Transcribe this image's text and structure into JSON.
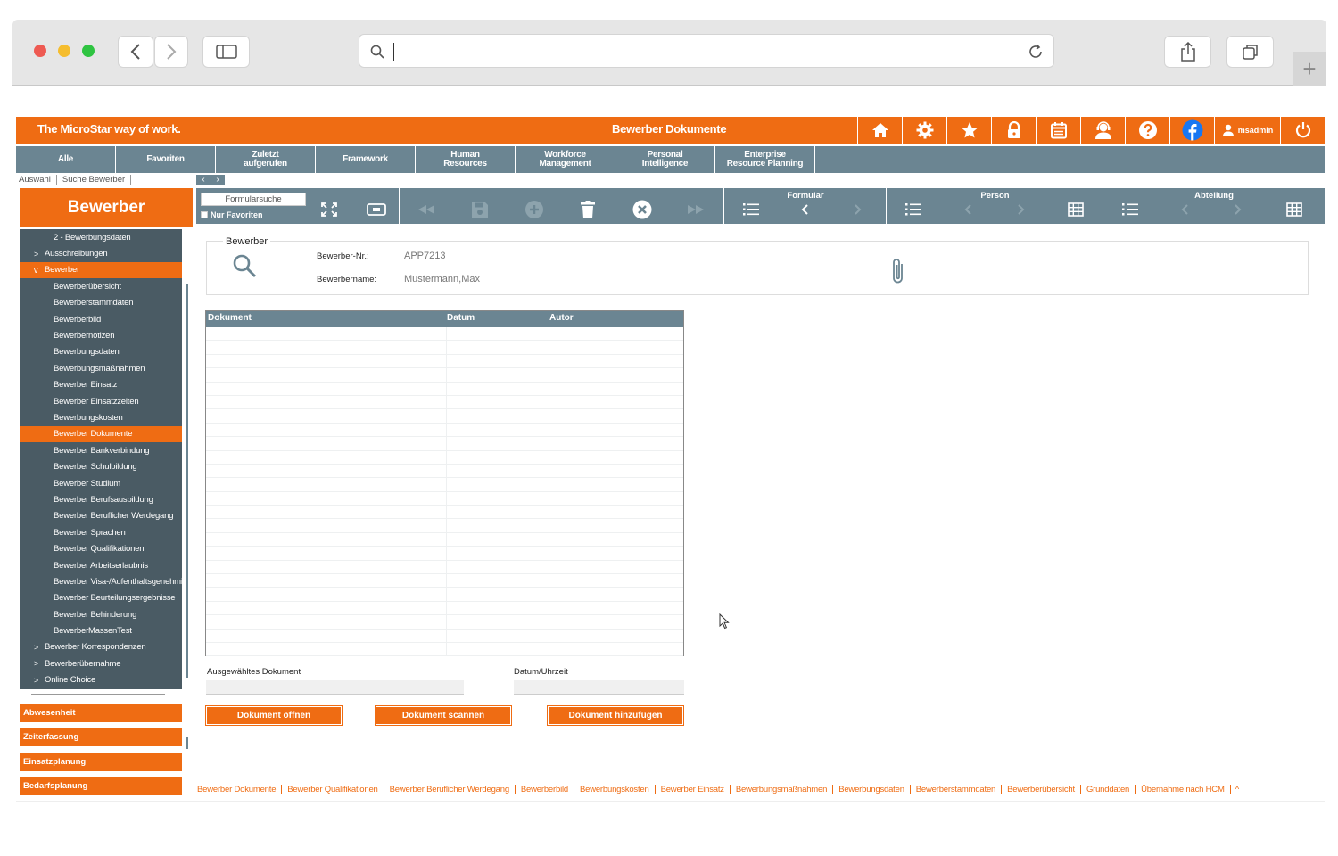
{
  "app": {
    "brand": "The MicroStar way of work.",
    "page_title": "Bewerber Dokumente",
    "user": "msadmin"
  },
  "nav": [
    "Alle",
    "Favoriten",
    "Zuletzt aufgerufen",
    "Framework",
    "Human Resources",
    "Workforce Management",
    "Personal Intelligence",
    "Enterprise Resource Planning"
  ],
  "breadcrumb": [
    "Auswahl",
    "Suche Bewerber"
  ],
  "sidebar": {
    "title": "Bewerber",
    "items": [
      {
        "label": "2 - Bewerbungsdaten",
        "level": 2,
        "caret": ""
      },
      {
        "label": "Ausschreibungen",
        "level": 1,
        "caret": ">"
      },
      {
        "label": "Bewerber",
        "level": 1,
        "caret": "v",
        "selected": true
      },
      {
        "label": "Bewerberübersicht",
        "level": 2,
        "caret": ""
      },
      {
        "label": "Bewerberstammdaten",
        "level": 2,
        "caret": ""
      },
      {
        "label": "Bewerberbild",
        "level": 2,
        "caret": ""
      },
      {
        "label": "Bewerbernotizen",
        "level": 2,
        "caret": ""
      },
      {
        "label": "Bewerbungsdaten",
        "level": 2,
        "caret": ""
      },
      {
        "label": "Bewerbungsmaßnahmen",
        "level": 2,
        "caret": ""
      },
      {
        "label": "Bewerber Einsatz",
        "level": 2,
        "caret": ""
      },
      {
        "label": "Bewerber Einsatzzeiten",
        "level": 2,
        "caret": ""
      },
      {
        "label": "Bewerbungskosten",
        "level": 2,
        "caret": ""
      },
      {
        "label": "Bewerber Dokumente",
        "level": 2,
        "caret": "",
        "selected": true
      },
      {
        "label": "Bewerber Bankverbindung",
        "level": 2,
        "caret": ""
      },
      {
        "label": "Bewerber Schulbildung",
        "level": 2,
        "caret": ""
      },
      {
        "label": "Bewerber Studium",
        "level": 2,
        "caret": ""
      },
      {
        "label": "Bewerber Berufsausbildung",
        "level": 2,
        "caret": ""
      },
      {
        "label": "Bewerber Beruflicher Werdegang",
        "level": 2,
        "caret": ""
      },
      {
        "label": "Bewerber Sprachen",
        "level": 2,
        "caret": ""
      },
      {
        "label": "Bewerber Qualifikationen",
        "level": 2,
        "caret": ""
      },
      {
        "label": "Bewerber Arbeitserlaubnis",
        "level": 2,
        "caret": ""
      },
      {
        "label": "Bewerber Visa-/Aufenthaltsgenehmigung",
        "level": 2,
        "caret": ""
      },
      {
        "label": "Bewerber Beurteilungsergebnisse",
        "level": 2,
        "caret": ""
      },
      {
        "label": "Bewerber Behinderung",
        "level": 2,
        "caret": ""
      },
      {
        "label": "BewerberMassenTest",
        "level": 2,
        "caret": ""
      },
      {
        "label": "Bewerber Korrespondenzen",
        "level": 1,
        "caret": ">"
      },
      {
        "label": "Bewerberübernahme",
        "level": 1,
        "caret": ">"
      },
      {
        "label": "Online Choice",
        "level": 1,
        "caret": ">"
      }
    ],
    "modules": [
      "Abwesenheit",
      "Zeiterfassung",
      "Einsatzplanung",
      "Bedarfsplanung"
    ]
  },
  "toolbar": {
    "search_placeholder": "Formularsuche",
    "only_favorites": "Nur Favoriten",
    "groups": [
      "Formular",
      "Person",
      "Abteilung"
    ]
  },
  "form": {
    "legend": "Bewerber",
    "nr_label": "Bewerber-Nr.:",
    "nr_value": "APP7213",
    "name_label": "Bewerbername:",
    "name_value": "Mustermann,Max"
  },
  "table": {
    "columns": [
      "Dokument",
      "Datum",
      "Autor"
    ],
    "rows": []
  },
  "selection": {
    "doc_label": "Ausgewähltes Dokument",
    "doc_value": "",
    "date_label": "Datum/Uhrzeit",
    "date_value": ""
  },
  "buttons": {
    "open": "Dokument öffnen",
    "scan": "Dokument scannen",
    "add": "Dokument hinzufügen"
  },
  "footer_links": [
    "Bewerber Dokumente",
    "Bewerber Qualifikationen",
    "Bewerber Beruflicher Werdegang",
    "Bewerberbild",
    "Bewerbungskosten",
    "Bewerber Einsatz",
    "Bewerbungsmaßnahmen",
    "Bewerbungsdaten",
    "Bewerberstammdaten",
    "Bewerberübersicht",
    "Grunddaten",
    "Übernahme nach HCM"
  ],
  "footer_more": "^",
  "colors": {
    "accent": "#ef6c13",
    "nav": "#6b8592",
    "sidebar": "#4a5b64"
  }
}
